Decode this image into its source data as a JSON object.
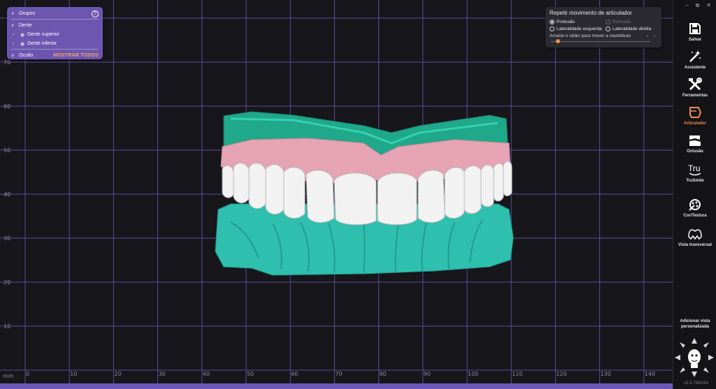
{
  "groups_panel": {
    "title": "Grupos",
    "help_icon": "help-circle-icon",
    "section": "Dente",
    "items": [
      {
        "label": "Dente superior"
      },
      {
        "label": "Dente inferior"
      }
    ],
    "hidden_label": "Oculto",
    "show_all": "MOSTRAR TODOS"
  },
  "articulator_panel": {
    "title": "Repetir movimento de articulador",
    "options": [
      {
        "label": "Protusão",
        "selected": true,
        "enabled": true
      },
      {
        "label": "Retrusão",
        "selected": false,
        "enabled": false
      },
      {
        "label": "Lateralidade esquerda",
        "selected": false,
        "enabled": true
      },
      {
        "label": "Lateralidade direita",
        "selected": false,
        "enabled": true
      }
    ],
    "slider_hint": "Arraste o slider para mover a mandíbula",
    "slider_arrows": "‹ ›",
    "slider_value": 0.05
  },
  "grid": {
    "x_ticks": [
      "0",
      "10",
      "20",
      "30",
      "40",
      "50",
      "60",
      "70",
      "80",
      "90",
      "100",
      "110",
      "120",
      "130",
      "140"
    ],
    "y_ticks": [
      "70",
      "60",
      "50",
      "40",
      "30",
      "20",
      "10"
    ],
    "unit": "mm"
  },
  "toolbar": {
    "window_controls": [
      "–",
      "⧉",
      "✕"
    ],
    "tools": [
      {
        "label": "Salvar",
        "icon": "save-icon",
        "active": false
      },
      {
        "label": "Assistente",
        "icon": "magic-wand-icon",
        "active": false
      },
      {
        "label": "Ferramentas",
        "icon": "tools-icon",
        "active": false
      },
      {
        "label": "Articulador",
        "icon": "articulator-icon",
        "active": true
      },
      {
        "label": "Oclusão",
        "icon": "occlusion-icon",
        "active": false
      },
      {
        "label": "TruSmile",
        "icon": "trusmile-icon",
        "active": false
      },
      {
        "label": "Cor/Textura",
        "icon": "color-texture-icon",
        "active": false
      },
      {
        "label": "Vista transversal",
        "icon": "cross-section-icon",
        "active": false
      }
    ],
    "custom_view_label": "Adicionar vista personalizada",
    "version": "v3.0-7662/64"
  },
  "colors": {
    "accent": "#f08a4b",
    "panel_purple": "#6d56b0",
    "grid_line": "#5a4e9a",
    "gum": "#e5a3b3",
    "model": "#2fbfae",
    "tooth": "#f2f2f2"
  }
}
